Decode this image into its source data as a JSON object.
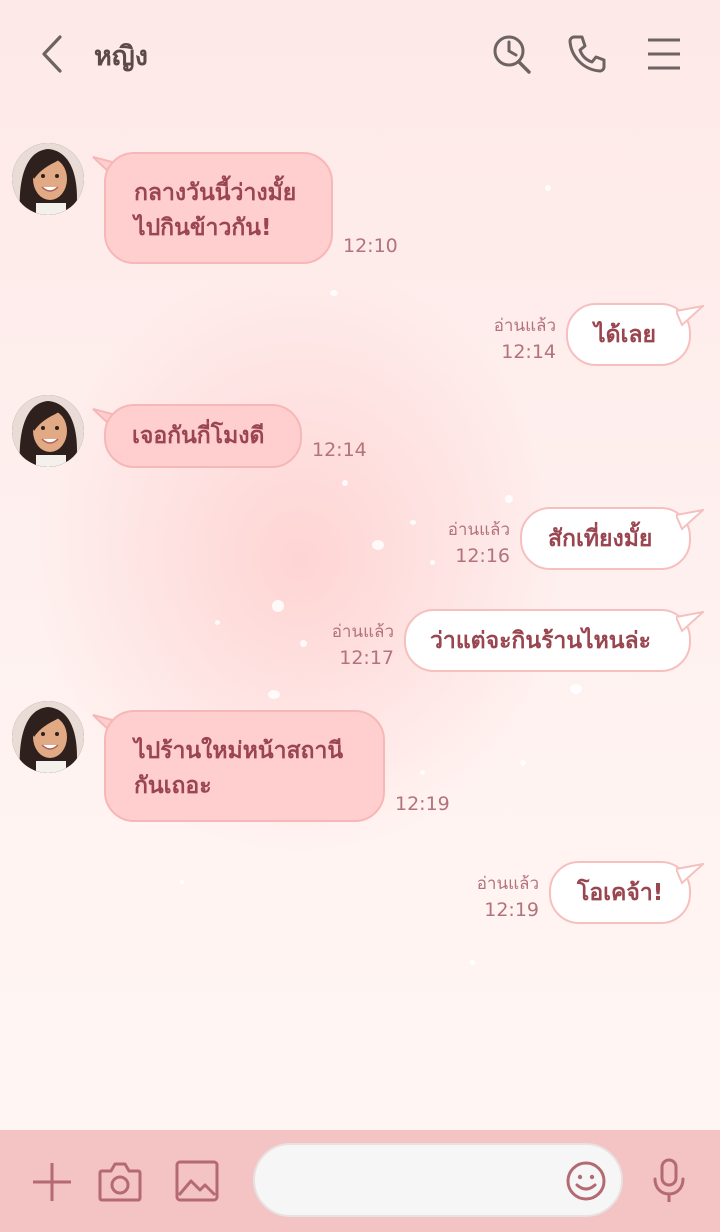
{
  "header": {
    "title": "หญิง",
    "back_icon": "chevron-left-icon",
    "search_icon": "search-clock-icon",
    "call_icon": "phone-icon",
    "menu_icon": "menu-icon"
  },
  "messages": [
    {
      "side": "incoming",
      "lines": [
        "กลางวันนี้ว่างมั้ย",
        "ไปกินข้าวกัน!"
      ],
      "time": "12:10"
    },
    {
      "side": "outgoing",
      "lines": [
        "ได้เลย"
      ],
      "read": "อ่านแล้ว",
      "time": "12:14"
    },
    {
      "side": "incoming",
      "lines": [
        "เจอกันกี่โมงดี"
      ],
      "time": "12:14"
    },
    {
      "side": "outgoing",
      "lines": [
        "สักเที่ยงมั้ย"
      ],
      "read": "อ่านแล้ว",
      "time": "12:16"
    },
    {
      "side": "outgoing",
      "lines": [
        "ว่าแต่จะกินร้านไหนล่ะ"
      ],
      "read": "อ่านแล้ว",
      "time": "12:17"
    },
    {
      "side": "incoming",
      "lines": [
        "ไปร้านใหม่หน้าสถานี",
        "กันเถอะ"
      ],
      "time": "12:19"
    },
    {
      "side": "outgoing",
      "lines": [
        "โอเคจ้า!"
      ],
      "read": "อ่านแล้ว",
      "time": "12:19"
    }
  ],
  "footer": {
    "plus_icon": "plus-icon",
    "camera_icon": "camera-icon",
    "image_icon": "image-icon",
    "input_value": "",
    "emoji_icon": "smiley-icon",
    "mic_icon": "microphone-icon"
  },
  "colors": {
    "incoming_bubble": "#ffcfcf",
    "outgoing_bubble": "#ffffff",
    "text": "#9a4650",
    "footer": "#f4c3c3"
  }
}
